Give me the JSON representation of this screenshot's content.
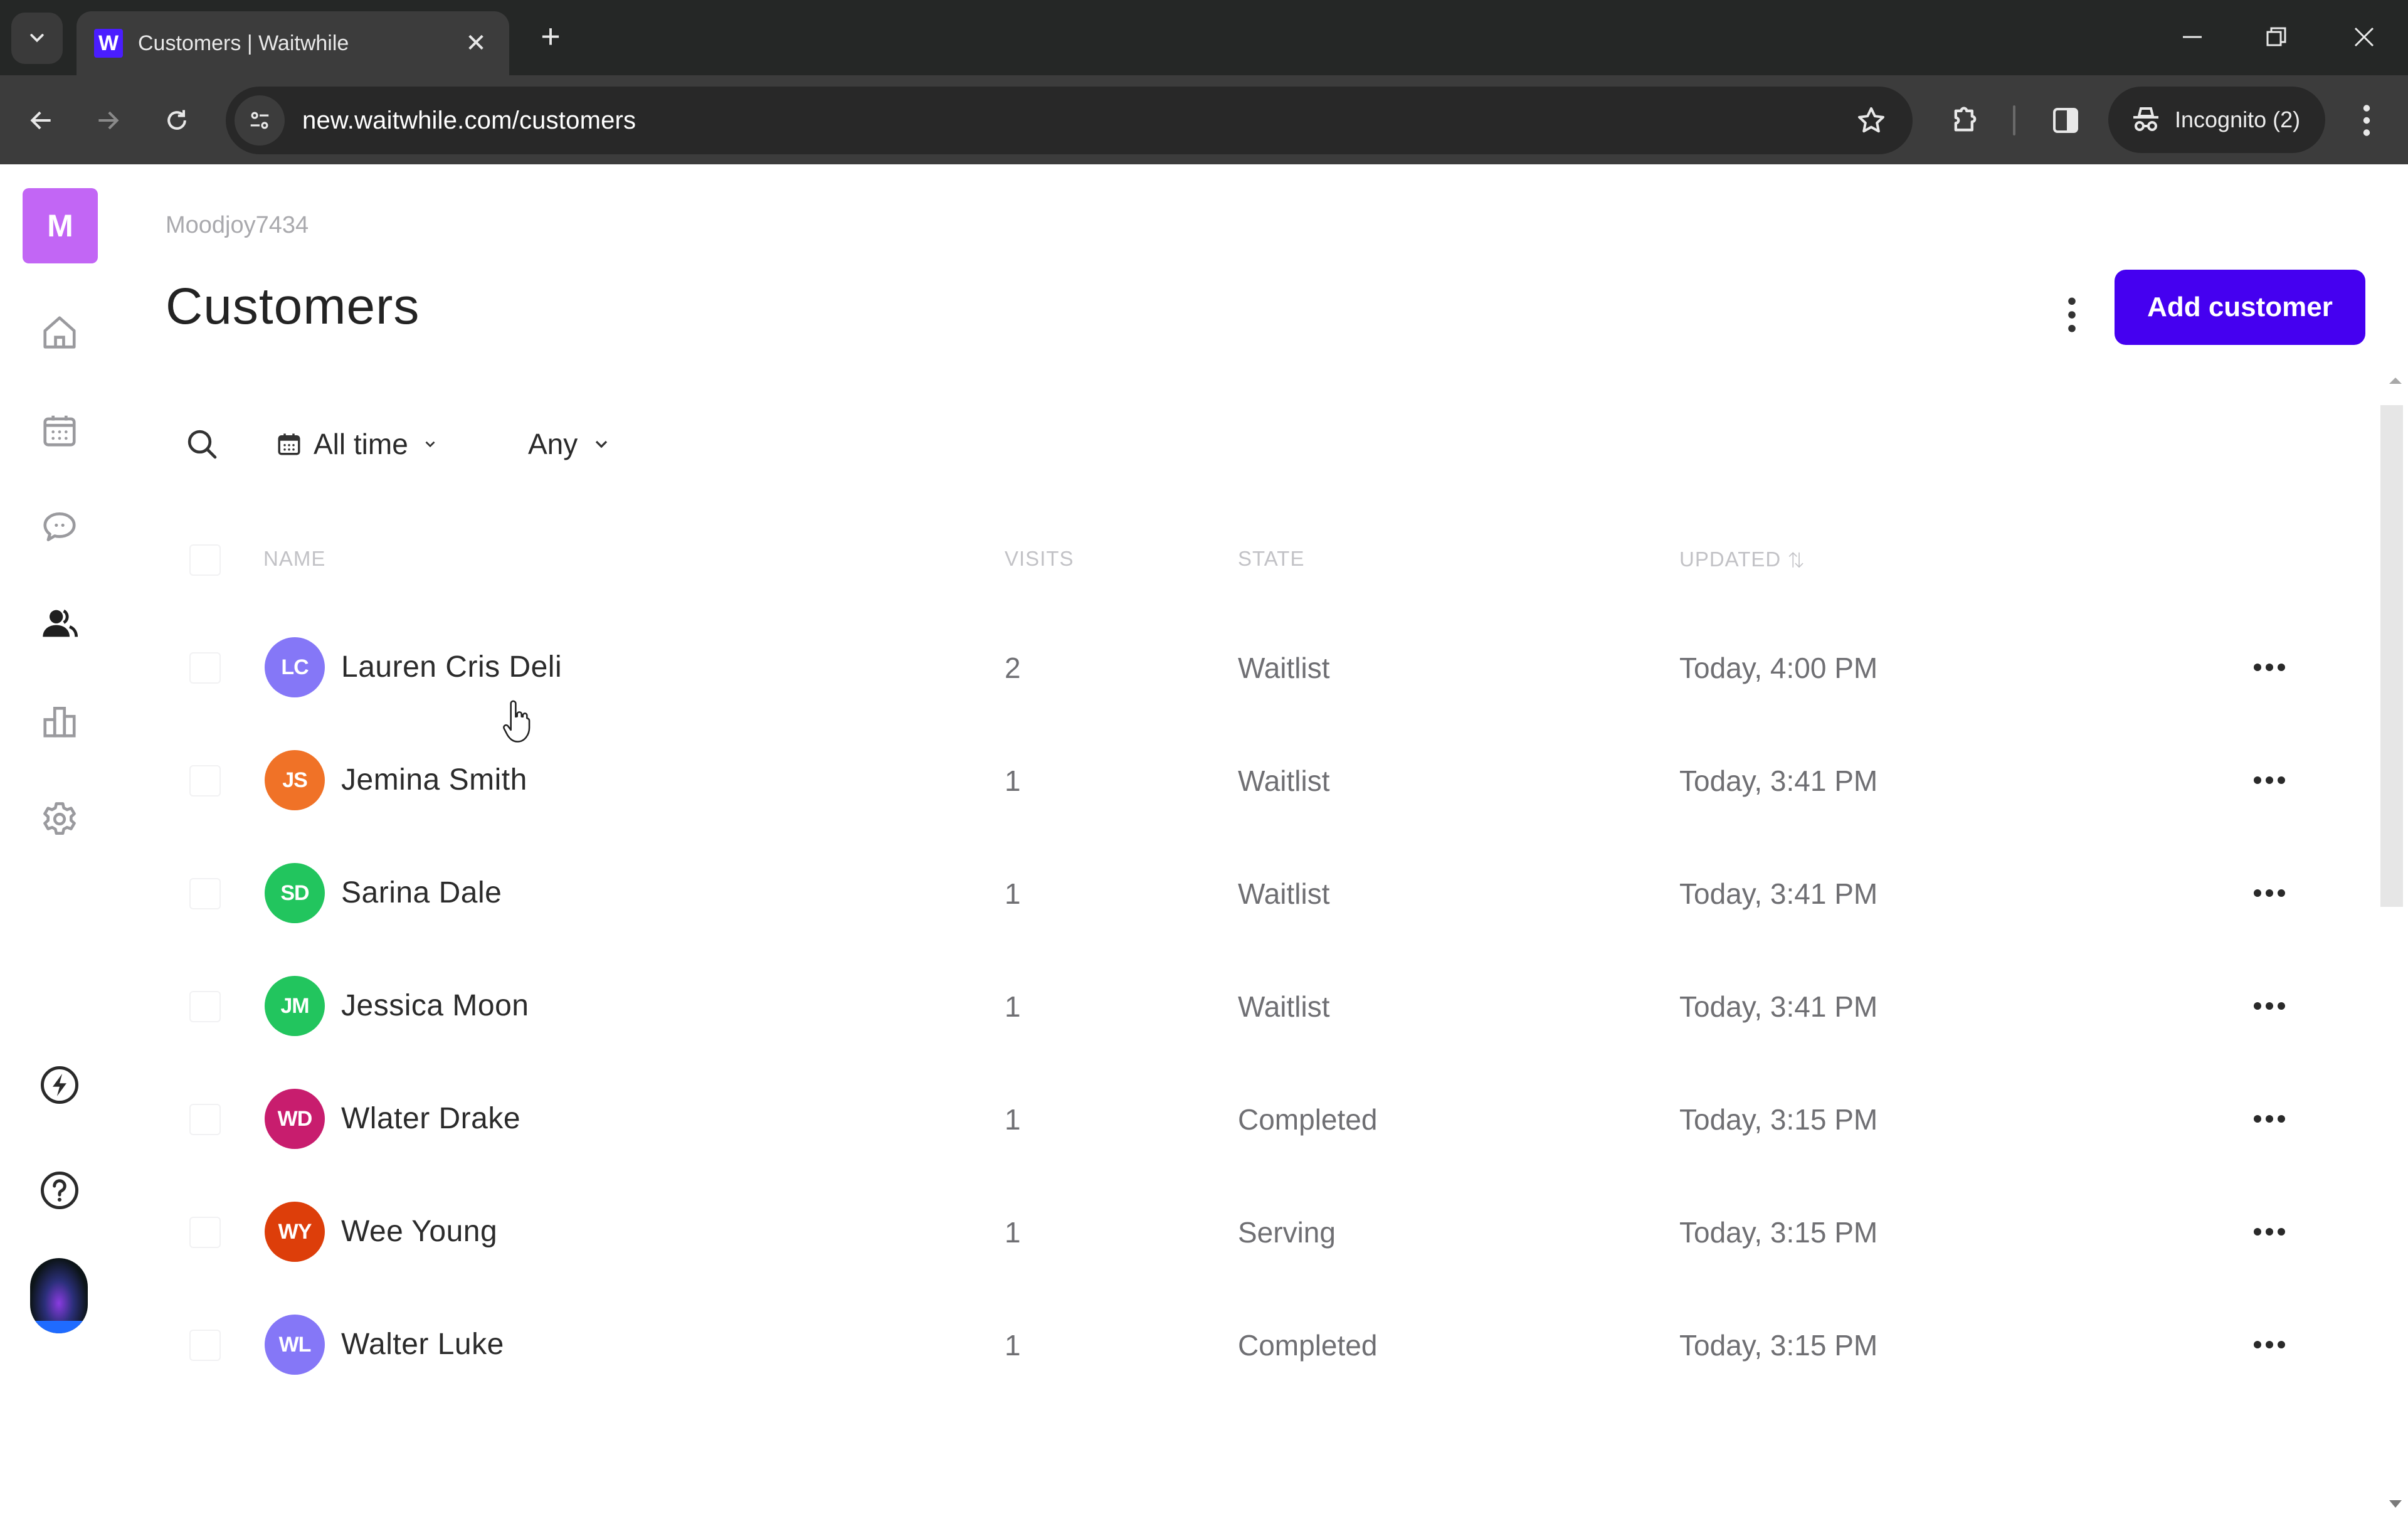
{
  "browser": {
    "tab_title": "Customers | Waitwhile",
    "favicon_letter": "W",
    "url": "new.waitwhile.com/customers",
    "incognito_label": "Incognito (2)",
    "new_tab_glyph": "+",
    "close_glyph": "✕"
  },
  "sidebar": {
    "org_initial": "M",
    "org_color": "#c266f5",
    "items": [
      {
        "name": "home",
        "icon": "home-icon",
        "active": false
      },
      {
        "name": "calendar",
        "icon": "calendar-icon",
        "active": false
      },
      {
        "name": "messages",
        "icon": "chat-icon",
        "active": false
      },
      {
        "name": "customers",
        "icon": "users-icon",
        "active": true
      },
      {
        "name": "analytics",
        "icon": "bar-chart-icon",
        "active": false
      },
      {
        "name": "settings",
        "icon": "gear-icon",
        "active": false
      }
    ],
    "bottom_items": [
      {
        "name": "whats-new",
        "icon": "lightning-icon"
      },
      {
        "name": "help",
        "icon": "help-icon"
      }
    ]
  },
  "header": {
    "org_name": "Moodjoy7434",
    "title": "Customers",
    "add_button_label": "Add customer",
    "accent_color": "#4500f0"
  },
  "filters": {
    "date_range": "All time",
    "state": "Any"
  },
  "table": {
    "columns": {
      "name": "NAME",
      "visits": "VISITS",
      "state": "STATE",
      "updated": "UPDATED ⇅"
    },
    "rows": [
      {
        "initials": "LC",
        "name": "Lauren Cris Deli",
        "visits": "2",
        "state": "Waitlist",
        "updated": "Today, 4:00 PM",
        "color": "#8577f7"
      },
      {
        "initials": "JS",
        "name": "Jemina Smith",
        "visits": "1",
        "state": "Waitlist",
        "updated": "Today, 3:41 PM",
        "color": "#f07227"
      },
      {
        "initials": "SD",
        "name": "Sarina Dale",
        "visits": "1",
        "state": "Waitlist",
        "updated": "Today, 3:41 PM",
        "color": "#22c55e"
      },
      {
        "initials": "JM",
        "name": "Jessica Moon",
        "visits": "1",
        "state": "Waitlist",
        "updated": "Today, 3:41 PM",
        "color": "#22c55e"
      },
      {
        "initials": "WD",
        "name": "Wlater Drake",
        "visits": "1",
        "state": "Completed",
        "updated": "Today, 3:15 PM",
        "color": "#c81d6e"
      },
      {
        "initials": "WY",
        "name": "Wee Young",
        "visits": "1",
        "state": "Serving",
        "updated": "Today, 3:15 PM",
        "color": "#dd3e0a"
      },
      {
        "initials": "WL",
        "name": "Walter Luke",
        "visits": "1",
        "state": "Completed",
        "updated": "Today, 3:15 PM",
        "color": "#8577f7"
      }
    ]
  }
}
